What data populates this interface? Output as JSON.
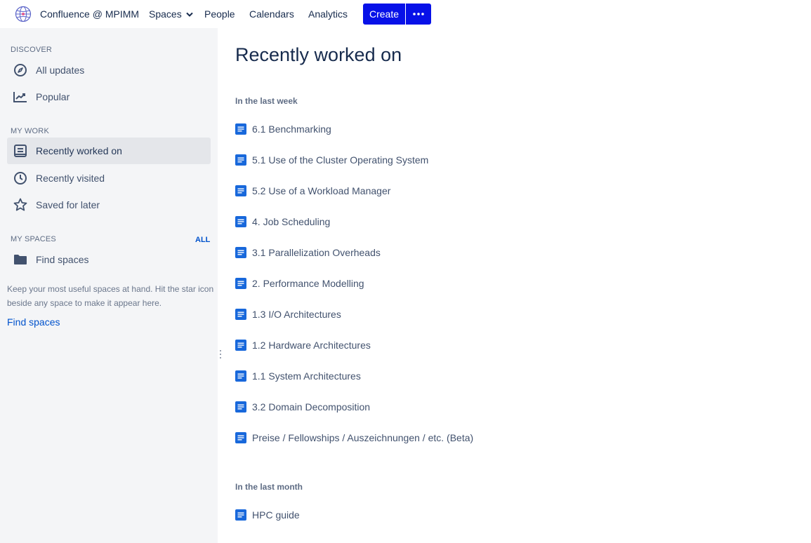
{
  "topbar": {
    "brand": "Confluence @ MPIMM",
    "nav": {
      "spaces": "Spaces",
      "people": "People",
      "calendars": "Calendars",
      "analytics": "Analytics"
    },
    "create_label": "Create",
    "more_icon": "more-horizontal-icon",
    "colors": {
      "primary": "#0711e8"
    }
  },
  "sidebar": {
    "discover_title": "DISCOVER",
    "discover": [
      {
        "label": "All updates",
        "icon": "compass-icon"
      },
      {
        "label": "Popular",
        "icon": "trending-icon"
      }
    ],
    "mywork_title": "MY WORK",
    "mywork": [
      {
        "label": "Recently worked on",
        "icon": "document-list-icon",
        "active": true
      },
      {
        "label": "Recently visited",
        "icon": "clock-icon"
      },
      {
        "label": "Saved for later",
        "icon": "star-icon"
      }
    ],
    "myspaces_title": "MY SPACES",
    "all_link": "ALL",
    "find_spaces_item": "Find spaces",
    "help_text_line1": "Keep your most useful spaces at hand. Hit the star icon",
    "help_text_line2": "beside any space to make it appear here.",
    "find_spaces_link": "Find spaces"
  },
  "main": {
    "title": "Recently worked on",
    "week_title": "In the last week",
    "week_items": [
      "6.1 Benchmarking",
      "5.1 Use of the Cluster Operating System",
      "5.2 Use of a Workload Manager",
      "4. Job Scheduling",
      "3.1 Parallelization Overheads",
      "2. Performance Modelling",
      "1.3 I/O Architectures",
      "1.2 Hardware Architectures",
      "1.1 System Architectures",
      "3.2 Domain Decomposition",
      "Preise / Fellowships / Auszeichnungen / etc. (Beta)"
    ],
    "month_title": "In the last month",
    "month_items": [
      "HPC guide"
    ]
  }
}
